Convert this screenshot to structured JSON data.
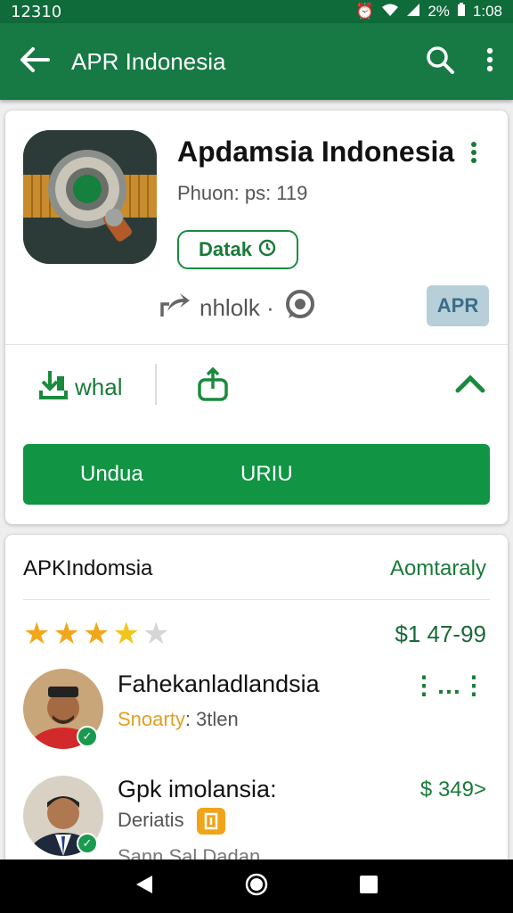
{
  "status": {
    "time": "12310",
    "battery": "2%",
    "clock": "1:08"
  },
  "appbar": {
    "title": "APR Indonesia"
  },
  "app": {
    "name": "Apdamsia Indonesia",
    "publisher": "Phuon: ps: 119",
    "chip_label": "Datak",
    "meta_text": "nhlolk ·",
    "apk_badge": "APR"
  },
  "actions": {
    "first_label": "whal"
  },
  "primary_button": {
    "label_left": "Undua",
    "label_right": "URIU"
  },
  "section": {
    "title": "APKIndomsia",
    "link": "Aomtaraly",
    "rating": 4,
    "rating_max": 5,
    "price": "$1 47-99"
  },
  "people": [
    {
      "name": "Fahekanladlandsia",
      "sub_a": "Snoarty",
      "sub_b": ": 3tlen",
      "trailing": "⋮…⋮"
    },
    {
      "name": "Gpk imolansia:",
      "sub_a": "Deriatis",
      "sub_b": "",
      "trailing": "$ 349>",
      "extra": "Sann Sal Dadan"
    }
  ],
  "colors": {
    "primary_dark": "#177a45",
    "primary": "#119443",
    "accent_green": "#1a7a3a",
    "star": "#f2a71b"
  },
  "icons": [
    "back-arrow-icon",
    "search-icon",
    "more-vert-icon",
    "download-icon",
    "share-icon",
    "chevron-up-icon",
    "whatsapp-icon",
    "star-icon",
    "verified-badge-icon",
    "tag-icon",
    "nav-back-icon",
    "nav-home-icon",
    "nav-recents-icon"
  ]
}
